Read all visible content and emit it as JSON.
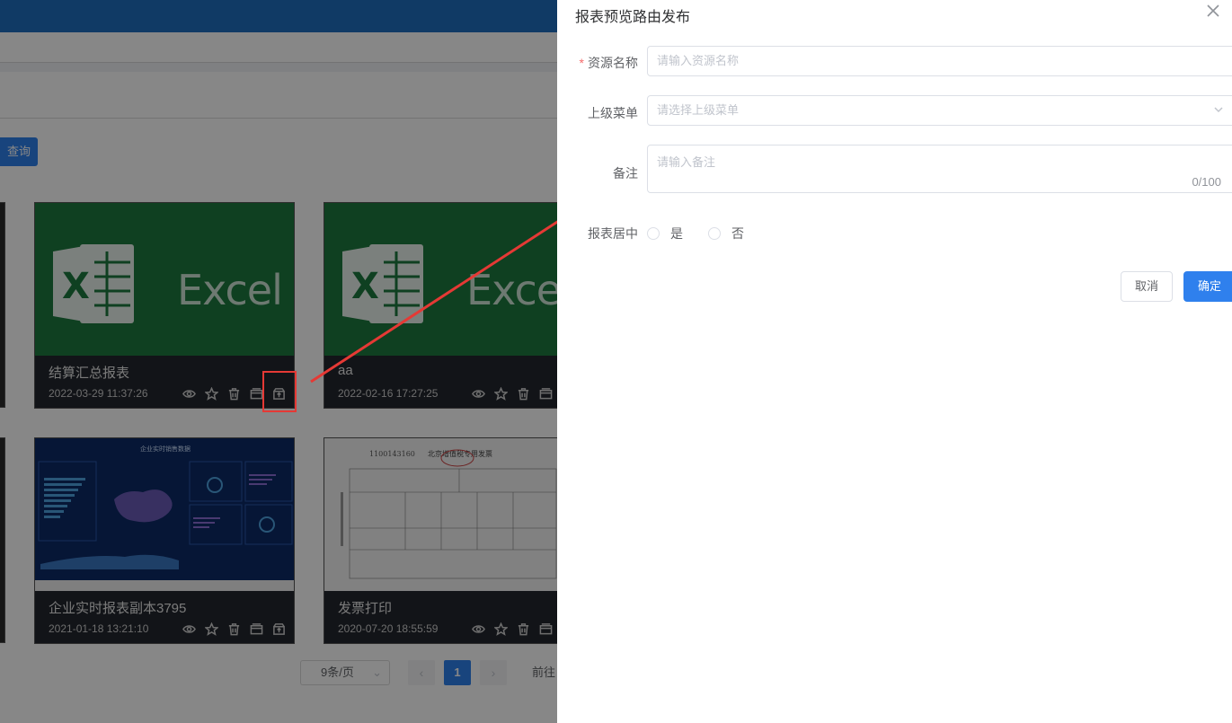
{
  "background": {
    "query_button": "查询",
    "cards": [
      {
        "title": "结算汇总报表",
        "date": "2022-03-29 11:37:26",
        "thumb": "excel",
        "thumb_text": "Excel"
      },
      {
        "title": "aa",
        "date": "2022-02-16 17:27:25",
        "thumb": "excel",
        "thumb_text": "Excel"
      },
      {
        "title": "企业实时报表副本3795",
        "date": "2021-01-18 13:21:10",
        "thumb": "dashboard",
        "thumb_text": "企业实时销售数据"
      },
      {
        "title": "发票打印",
        "date": "2020-07-20 18:55:59",
        "thumb": "invoice",
        "thumb_text": "北京增值税专用发票",
        "thumb_number": "1100143160"
      }
    ],
    "card_action_icons": [
      "eye-icon",
      "star-icon",
      "trash-icon",
      "folder-icon",
      "publish-icon"
    ],
    "pagination": {
      "page_size": "9条/页",
      "current_page": "1",
      "goto_label": "前往"
    }
  },
  "drawer": {
    "title": "报表预览路由发布",
    "fields": {
      "resource_name": {
        "label": "资源名称",
        "required_mark": "*",
        "placeholder": "请输入资源名称"
      },
      "parent_menu": {
        "label": "上级菜单",
        "placeholder": "请选择上级菜单"
      },
      "remark": {
        "label": "备注",
        "placeholder": "请输入备注",
        "counter": "0/100"
      },
      "center_report": {
        "label": "报表居中",
        "options": [
          "是",
          "否"
        ]
      }
    },
    "buttons": {
      "cancel": "取消",
      "confirm": "确定"
    }
  },
  "colors": {
    "primary": "#2f80ed",
    "excel_green": "#1d7a3f",
    "annotation_red": "#e53935"
  }
}
